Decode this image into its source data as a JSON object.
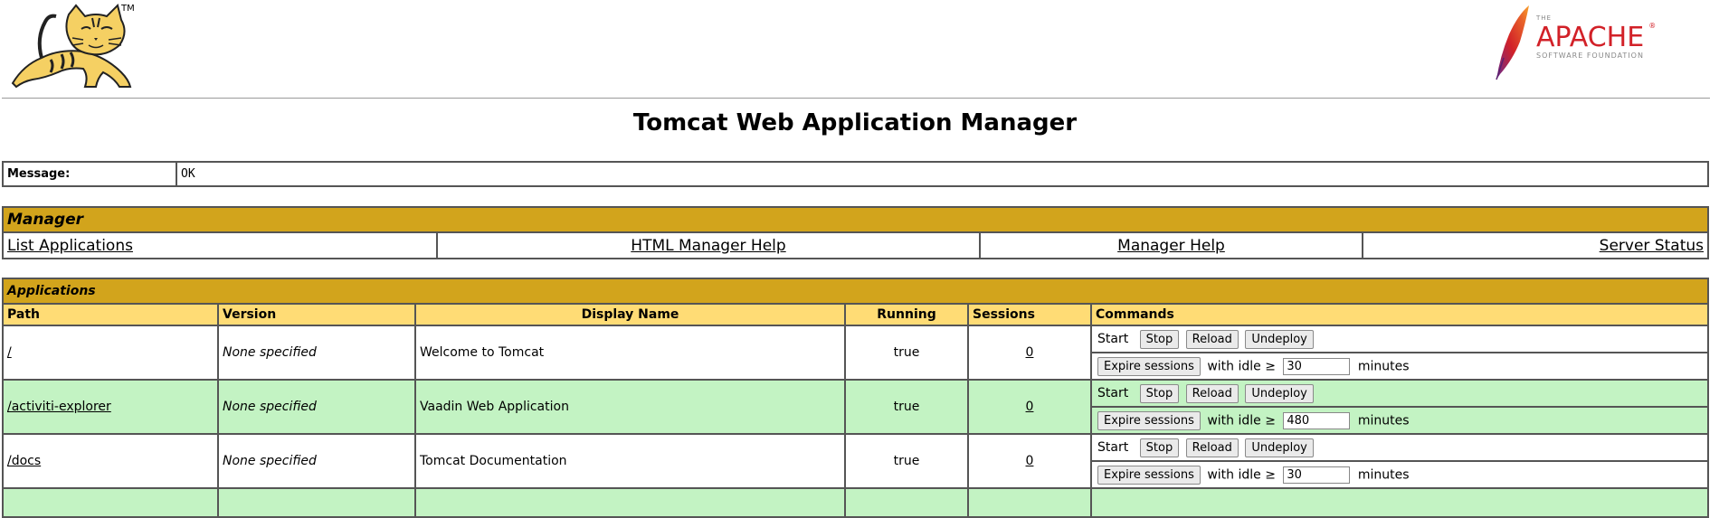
{
  "header": {
    "title": "Tomcat Web Application Manager",
    "tomcat_tm": "TM",
    "apache_the": "THE",
    "apache_name": "APACHE",
    "apache_tm": "®",
    "apache_sub": "SOFTWARE FOUNDATION"
  },
  "message": {
    "label": "Message:",
    "value": "OK"
  },
  "manager": {
    "heading": "Manager",
    "links": [
      "List Applications",
      "HTML Manager Help",
      "Manager Help",
      "Server Status"
    ]
  },
  "applications": {
    "heading": "Applications",
    "columns": [
      "Path",
      "Version",
      "Display Name",
      "Running",
      "Sessions",
      "Commands"
    ],
    "start_label": "Start",
    "buttons": {
      "stop": "Stop",
      "reload": "Reload",
      "undeploy": "Undeploy",
      "expire": "Expire sessions"
    },
    "idle_prefix": "with idle ≥",
    "idle_suffix": "minutes",
    "rows": [
      {
        "path": "/",
        "version": "None specified",
        "display_name": "Welcome to Tomcat",
        "running": "true",
        "sessions": "0",
        "idle": "30"
      },
      {
        "path": "/activiti-explorer",
        "version": "None specified",
        "display_name": "Vaadin Web Application",
        "running": "true",
        "sessions": "0",
        "idle": "480"
      },
      {
        "path": "/docs",
        "version": "None specified",
        "display_name": "Tomcat Documentation",
        "running": "true",
        "sessions": "0",
        "idle": "30"
      }
    ]
  },
  "colors": {
    "section_head": "#D2A41C",
    "column_head": "#FFDC75",
    "row_alt": "#C3F3C3",
    "apache_red": "#D22128"
  }
}
